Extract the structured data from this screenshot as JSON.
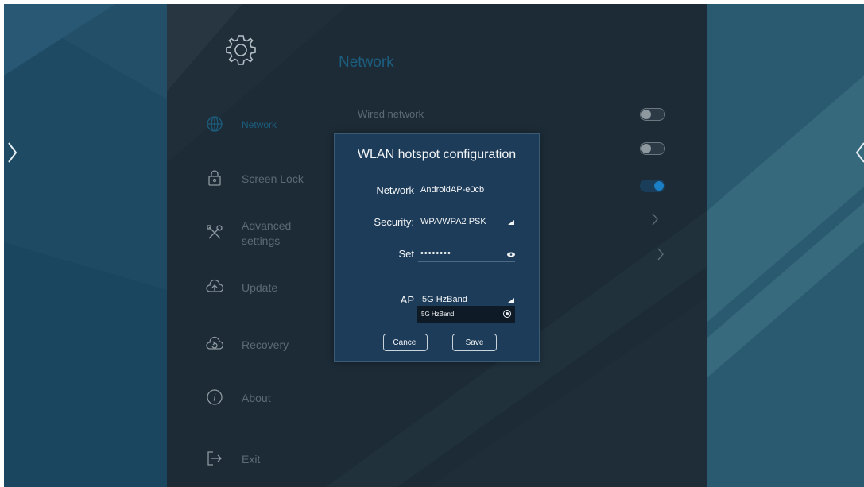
{
  "colors": {
    "background": "#1e4a63",
    "panel": "#1c2a35",
    "accent": "#1c5d7e",
    "dialog": "#1d3c59",
    "toggle_on": "#1a7fc4"
  },
  "page": {
    "title": "Network"
  },
  "sidebar": {
    "items": [
      {
        "label": "Network",
        "icon": "globe-icon",
        "active": true
      },
      {
        "label": "Screen Lock",
        "icon": "lock-icon",
        "active": false
      },
      {
        "label": "Advanced\nsettings",
        "icon": "tools-icon",
        "active": false
      },
      {
        "label": "Update",
        "icon": "cloud-upload-icon",
        "active": false
      },
      {
        "label": "Recovery",
        "icon": "cloud-restore-icon",
        "active": false
      },
      {
        "label": "About",
        "icon": "info-icon",
        "active": false
      },
      {
        "label": "Exit",
        "icon": "exit-icon",
        "active": false
      }
    ]
  },
  "settings": {
    "wired_network": {
      "label": "Wired network",
      "on": false
    }
  },
  "dialog": {
    "title": "WLAN hotspot configuration",
    "network_label": "Network",
    "network_value": "AndroidAP-e0cb",
    "security_label": "Security:",
    "security_value": "WPA/WPA2 PSK",
    "password_label": "Set",
    "password_value": "••••••••",
    "ap_label": "AP",
    "ap_value": "5G HzBand",
    "ap_options": [
      "5G HzBand"
    ],
    "cancel_label": "Cancel",
    "save_label": "Save"
  }
}
